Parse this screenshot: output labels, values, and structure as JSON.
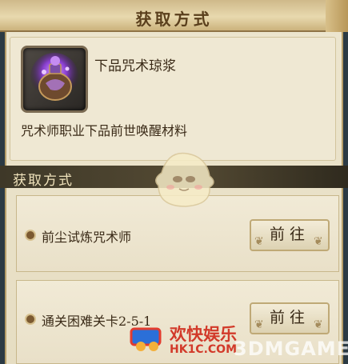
{
  "header": {
    "title": "获取方式"
  },
  "item": {
    "name": "下品咒术琼浆",
    "description": "咒术师职业下品前世唤醒材料"
  },
  "section": {
    "title": "获取方式"
  },
  "sources": [
    {
      "label": "前尘试炼咒术师",
      "button": "前往"
    },
    {
      "label": "通关困难关卡2-5-1",
      "button": "前往"
    }
  ],
  "watermark": {
    "text1": "欢快娱乐",
    "text2": "HK1C.COM",
    "text3": "3DMGAME"
  },
  "colors": {
    "panel": "#ede6cf",
    "text": "#3a2a17",
    "section_bar": "#3e3828",
    "watermark_red": "#d23a2a"
  }
}
